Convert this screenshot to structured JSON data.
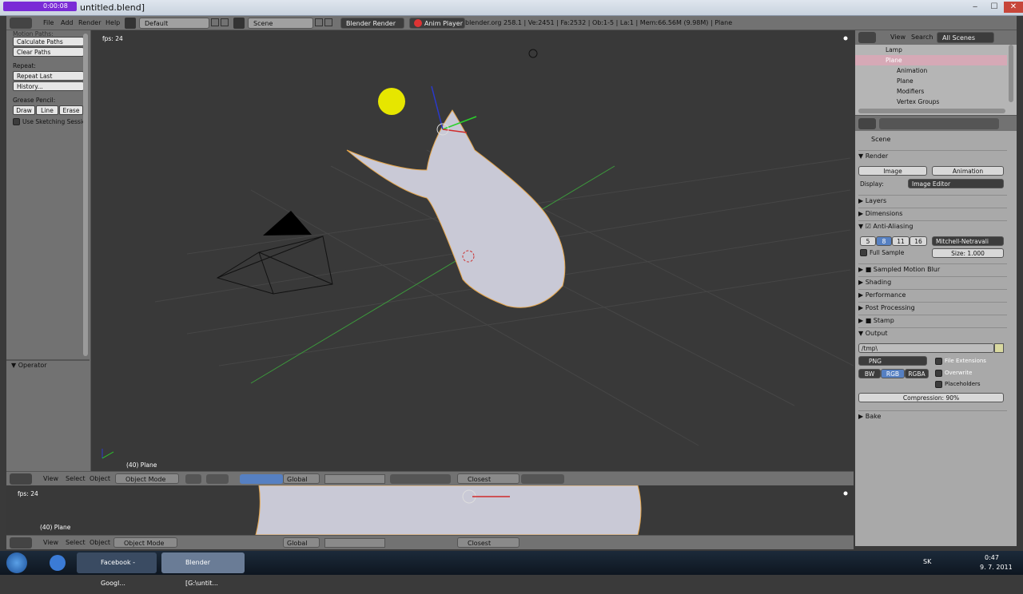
{
  "window": {
    "title": "untitled.blend]",
    "recorder_time": "0:00:08",
    "min": "‒",
    "max": "☐",
    "close": "✕"
  },
  "info_header": {
    "menu": [
      "File",
      "Add",
      "Render",
      "Help"
    ],
    "layout": "Default",
    "scene": "Scene",
    "engine": "Blender Render",
    "anim_player": "Anim Player",
    "stats": "blender.org 258.1 | Ve:2451 | Fa:2532 | Ob:1-5 | La:1 | Mem:66.56M (9.98M) | Plane"
  },
  "toolshelf": {
    "motion_paths_label": "Motion Paths:",
    "calculate_paths": "Calculate Paths",
    "clear_paths": "Clear Paths",
    "repeat_label": "Repeat:",
    "repeat_last": "Repeat Last",
    "history": "History...",
    "grease_label": "Grease Pencil:",
    "draw": "Draw",
    "line": "Line",
    "erase": "Erase",
    "sketching": "Use Sketching Sessio",
    "operator": "Operator"
  },
  "viewport": {
    "fps": "fps: 24",
    "object_label": "(40) Plane"
  },
  "viewport_header": {
    "view": "View",
    "select": "Select",
    "object": "Object",
    "mode": "Object Mode",
    "orientation": "Global",
    "snap": "Closest"
  },
  "viewport2": {
    "fps": "fps: 24",
    "object_label": "(40) Plane"
  },
  "outliner": {
    "view": "View",
    "search": "Search",
    "filter": "All Scenes",
    "rows": [
      "Lamp",
      "Plane",
      "Animation",
      "Plane",
      "Modifiers",
      "Vertex Groups"
    ]
  },
  "properties": {
    "scene": "Scene",
    "render": "Render",
    "image": "Image",
    "animation": "Animation",
    "display_label": "Display:",
    "display_value": "Image Editor",
    "layers": "Layers",
    "dimensions": "Dimensions",
    "anti_aliasing": "Anti-Aliasing",
    "aa_samples": [
      "5",
      "8",
      "11",
      "16"
    ],
    "filter": "Mitchell-Netravali",
    "full_sample": "Full Sample",
    "size": "Size: 1.000",
    "motion_blur": "Sampled Motion Blur",
    "shading": "Shading",
    "performance": "Performance",
    "post_processing": "Post Processing",
    "stamp": "Stamp",
    "output": "Output",
    "output_path": "/tmp\\",
    "format": "PNG",
    "file_extensions": "File Extensions",
    "overwrite": "Overwrite",
    "placeholders": "Placeholders",
    "bw": "BW",
    "rgb": "RGB",
    "rgba": "RGBA",
    "compression": "Compression: 90%",
    "bake": "Bake"
  },
  "taskbar": {
    "chrome": "Facebook - Googl...",
    "blender": "Blender [G:\\untit...",
    "lang": "SK",
    "time": "0:47",
    "date": "9. 7. 2011"
  }
}
